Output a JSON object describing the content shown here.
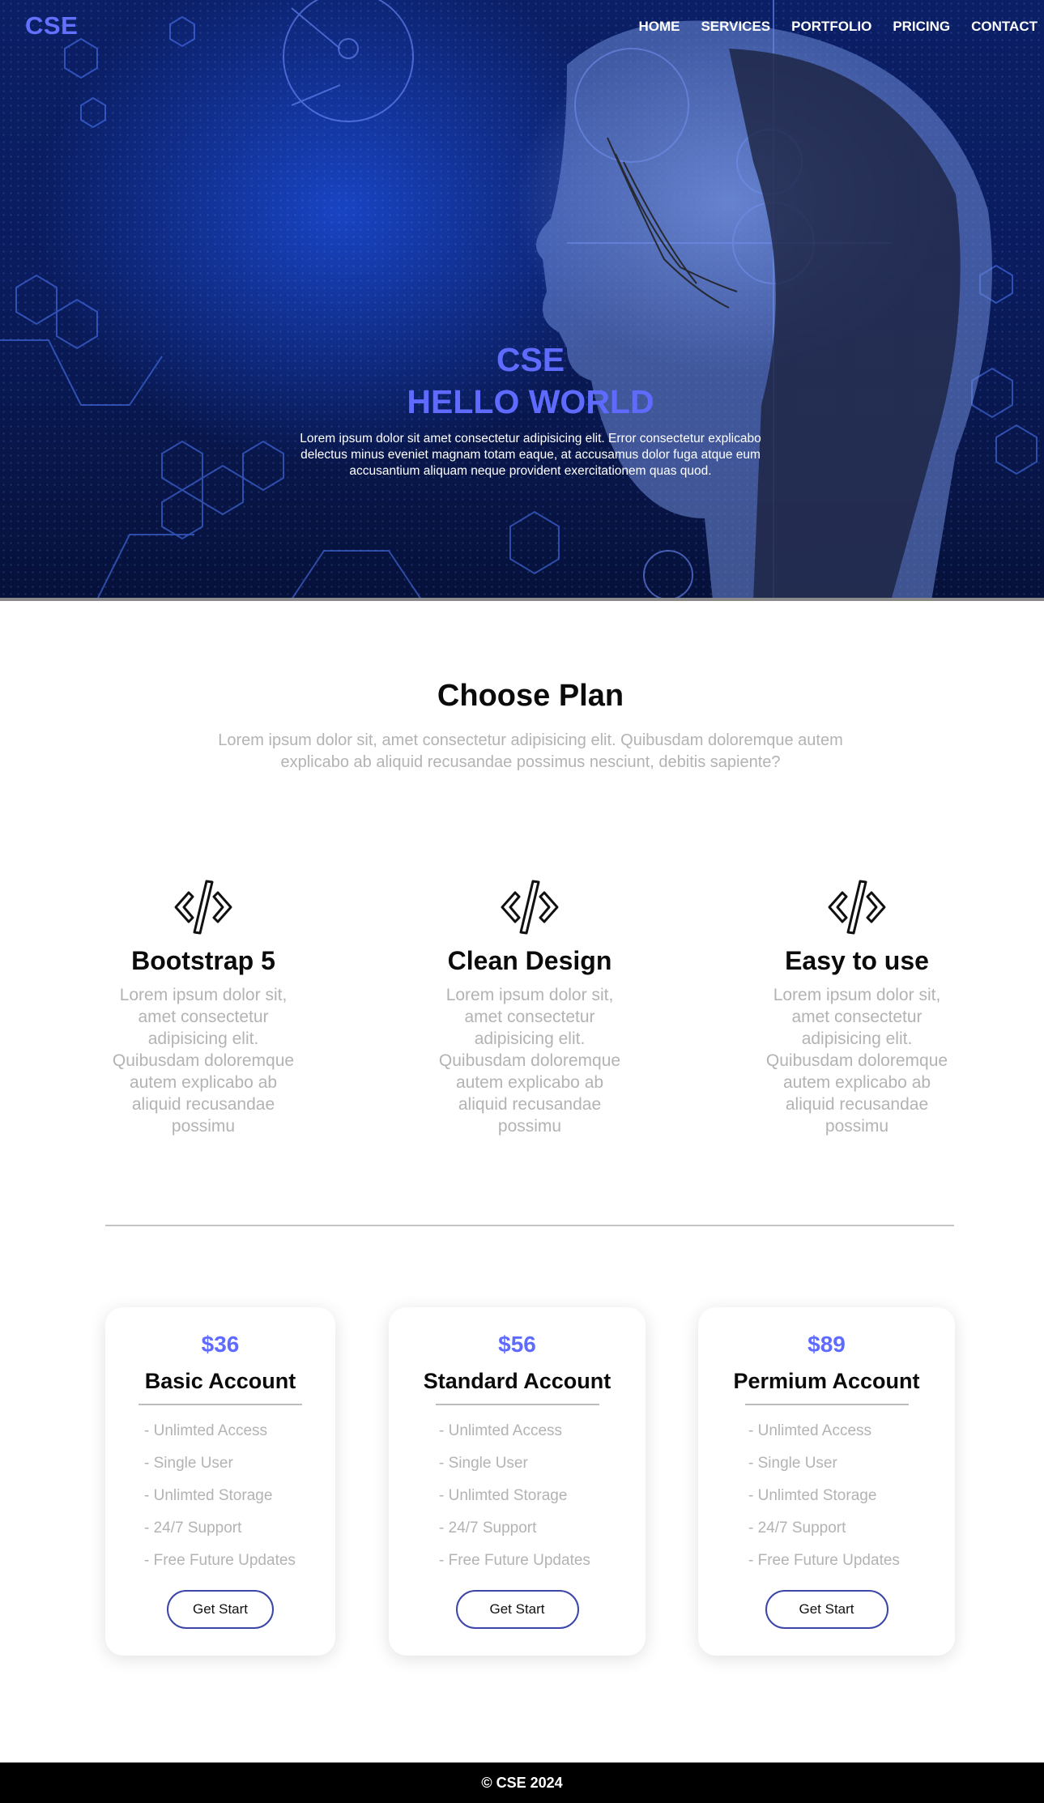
{
  "header": {
    "logo": "CSE",
    "nav": [
      "HOME",
      "SERVICES",
      "PORTFOLIO",
      "PRICING",
      "CONTACT"
    ]
  },
  "hero": {
    "title_line1": "CSE",
    "title_line2": "HELLO WORLD",
    "text": "Lorem ipsum dolor sit amet consectetur adipisicing elit. Error consectetur explicabo delectus minus eveniet magnam totam eaque, at accusamus dolor fuga atque eum accusantium aliquam neque provident exercitationem quas quod."
  },
  "plan": {
    "title": "Choose Plan",
    "subtitle": "Lorem ipsum dolor sit, amet consectetur adipisicing elit. Quibusdam doloremque autem explicabo ab aliquid recusandae possimus nesciunt, debitis sapiente?"
  },
  "features": [
    {
      "icon": "code-icon",
      "title": "Bootstrap 5",
      "text": "Lorem ipsum dolor sit, amet consectetur adipisicing elit. Quibusdam doloremque autem explicabo ab aliquid recusandae possimu"
    },
    {
      "icon": "code-icon",
      "title": "Clean Design",
      "text": "Lorem ipsum dolor sit, amet consectetur adipisicing elit. Quibusdam doloremque autem explicabo ab aliquid recusandae possimu"
    },
    {
      "icon": "code-icon",
      "title": "Easy to use",
      "text": "Lorem ipsum dolor sit, amet consectetur adipisicing elit. Quibusdam doloremque autem explicabo ab aliquid recusandae possimu"
    }
  ],
  "pricing": [
    {
      "price": "$36",
      "name": "Basic Account",
      "items": [
        "- Unlimted Access",
        "- Single User",
        "- Unlimted Storage",
        "- 24/7 Support",
        "- Free Future Updates"
      ],
      "button": "Get Start"
    },
    {
      "price": "$56",
      "name": "Standard Account",
      "items": [
        "- Unlimted Access",
        "- Single User",
        "- Unlimted Storage",
        "- 24/7 Support",
        "- Free Future Updates"
      ],
      "button": "Get Start"
    },
    {
      "price": "$89",
      "name": "Permium Account",
      "items": [
        "- Unlimted Access",
        "- Single User",
        "- Unlimted Storage",
        "- 24/7 Support",
        "- Free Future Updates"
      ],
      "button": "Get Start"
    }
  ],
  "footer": {
    "text": "© CSE 2024"
  },
  "colors": {
    "accent": "#5f6bff",
    "muted_text": "#b3b3b3",
    "hero_bg": "#0b1f66",
    "footer_bg": "#000000",
    "button_border": "#3b46a8"
  }
}
